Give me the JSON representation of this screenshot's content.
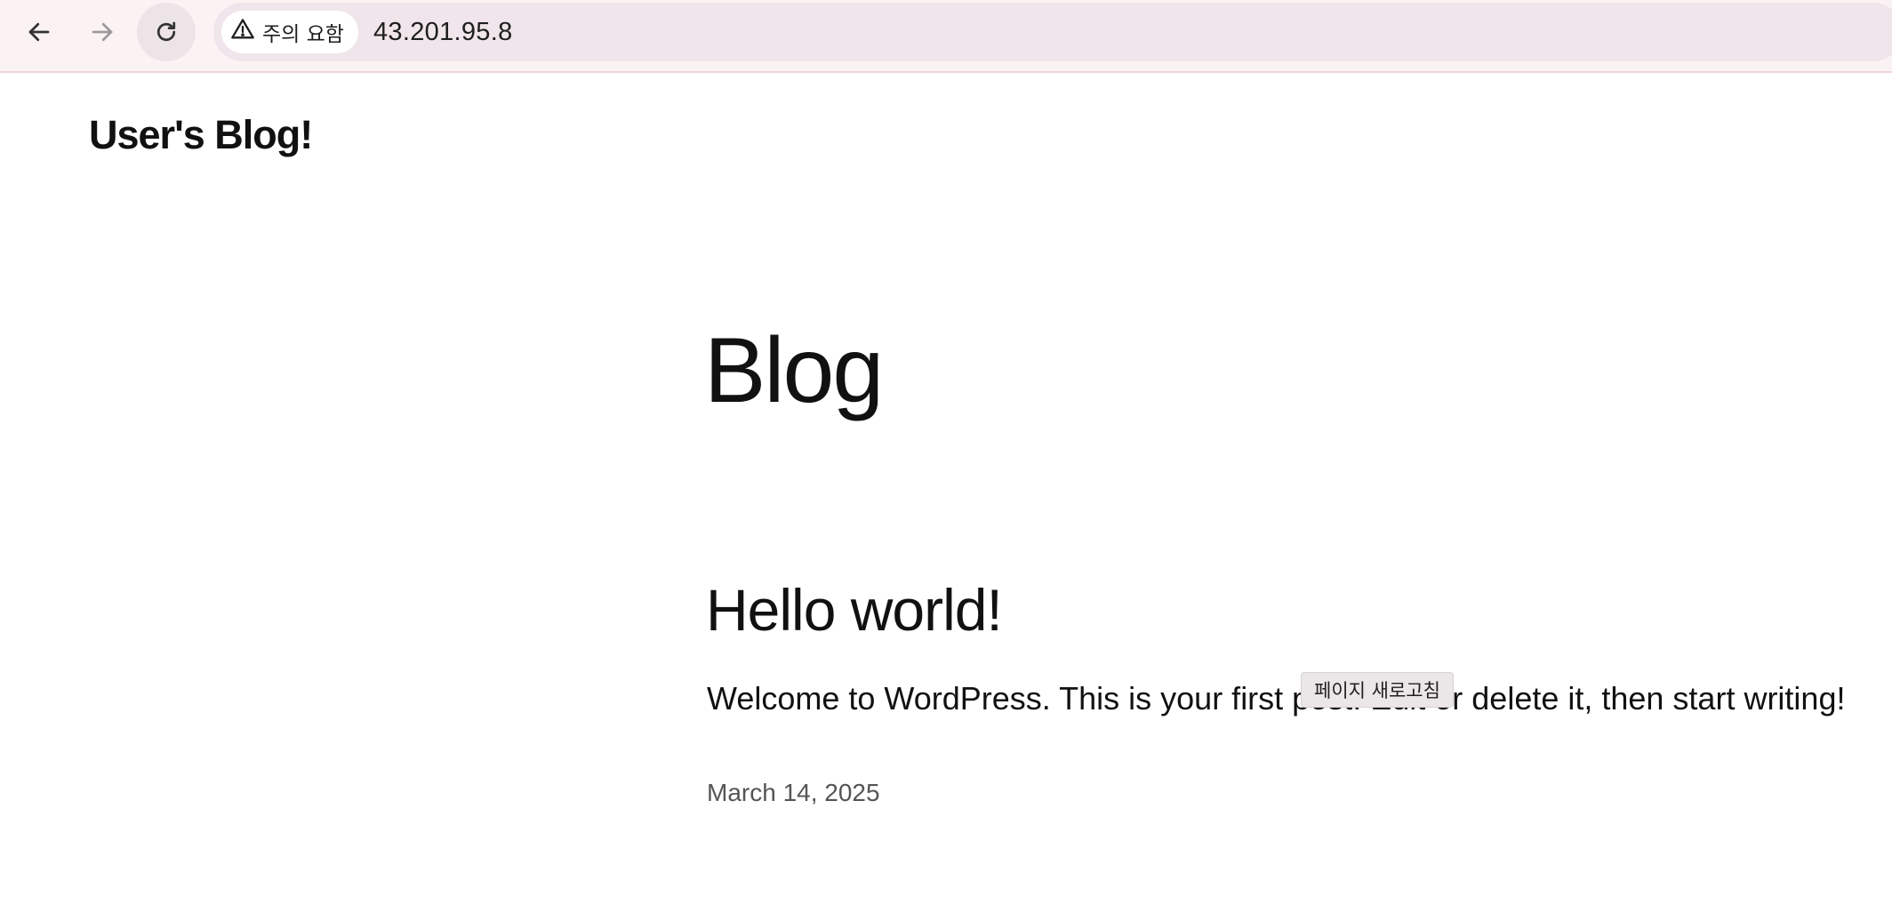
{
  "browser": {
    "back_icon": "arrow-left-icon",
    "forward_icon": "arrow-right-icon",
    "reload_icon": "reload-icon",
    "security_icon": "warning-triangle-icon",
    "security_label": "주의 요함",
    "url": "43.201.95.8",
    "tooltip": "페이지 새로고침"
  },
  "site": {
    "title": "User's Blog!"
  },
  "page": {
    "heading": "Blog"
  },
  "posts": [
    {
      "title": "Hello world!",
      "excerpt": "Welcome to WordPress. This is your first post. Edit or delete it, then start writing!",
      "date": "March 14, 2025"
    }
  ],
  "colors": {
    "toolbar_bg": "#fbf3f3",
    "omnibox_bg": "#f0e5ea",
    "text": "#111111",
    "date_text": "#555555"
  }
}
